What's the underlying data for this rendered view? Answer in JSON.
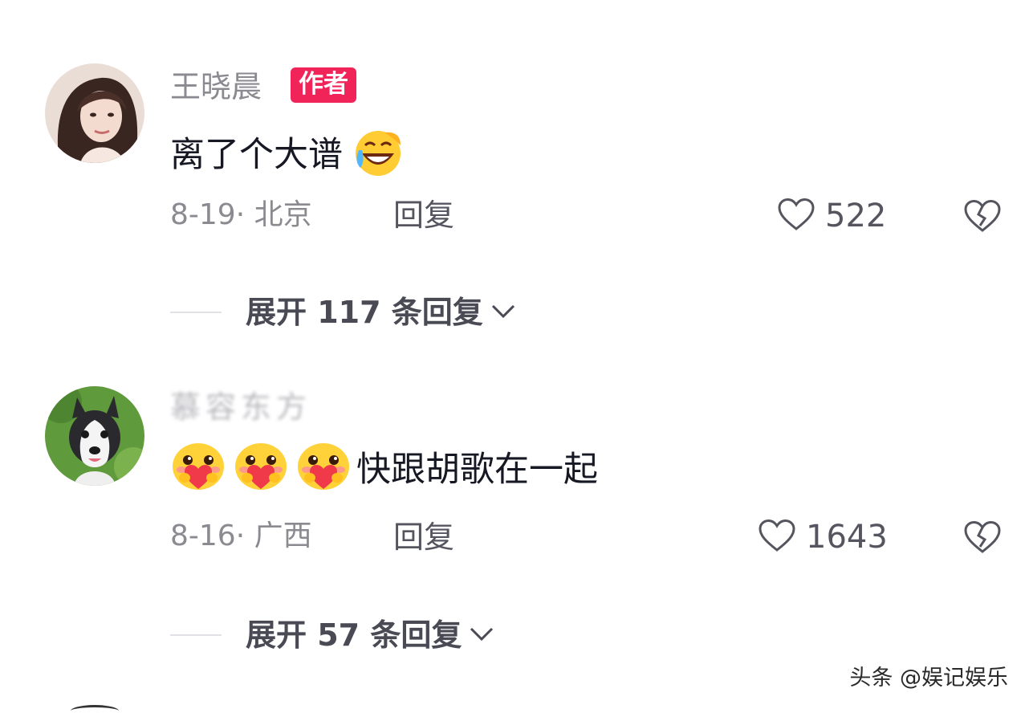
{
  "comments": [
    {
      "username": "王晓晨",
      "badge": "作者",
      "text": "离了个大谱",
      "date_location": "8-19· 北京",
      "reply_label": "回复",
      "likes": "522",
      "expand_label": "展开 117 条回复"
    },
    {
      "username": "慕容东方",
      "text": "快跟胡歌在一起",
      "date_location": "8-16· 广西",
      "reply_label": "回复",
      "likes": "1643",
      "expand_label": "展开 57 条回复"
    }
  ],
  "watermark": "头条 @娱记娱乐",
  "icons": {
    "like": "heart-outline-icon",
    "dislike": "broken-heart-icon",
    "expand": "chevron-down-icon",
    "emoji_1": "laugh-cry-emoji",
    "emoji_2": "heart-hug-emoji"
  },
  "colors": {
    "badge": "#f1245a",
    "text": "#161823",
    "muted": "#8a8a90"
  }
}
